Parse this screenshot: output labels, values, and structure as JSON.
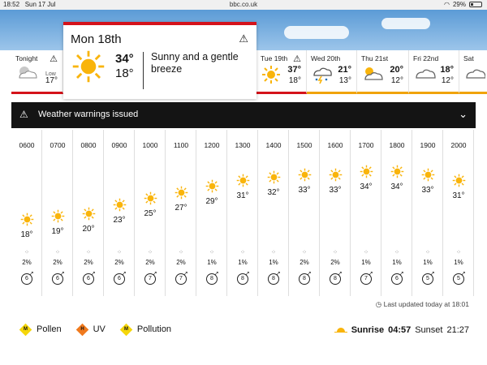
{
  "status": {
    "time": "18:52",
    "date": "Sun 17 Jul",
    "url": "bbc.co.uk",
    "battery": "29%",
    "battery_level": 0.29
  },
  "selected_day": {
    "name": "Mon 18th",
    "high": "34°",
    "low": "18°",
    "description": "Sunny and a gentle breeze",
    "icon": "sunny-icon"
  },
  "days": [
    {
      "name": "Tonight",
      "low_label": "Low",
      "low": "17°",
      "icon": "partly-cloudy-night-icon",
      "warning": true
    },
    {
      "name": "Tue 19th",
      "high": "37°",
      "low": "18°",
      "icon": "sunny-icon",
      "warning": true
    },
    {
      "name": "Wed 20th",
      "high": "21°",
      "low": "13°",
      "icon": "thunder-rain-icon"
    },
    {
      "name": "Thu 21st",
      "high": "20°",
      "low": "12°",
      "icon": "sunny-cloud-icon"
    },
    {
      "name": "Fri 22nd",
      "high": "18°",
      "low": "12°",
      "icon": "cloud-icon"
    },
    {
      "name": "Sat",
      "icon": "cloud-icon"
    }
  ],
  "warnings": {
    "label": "Weather warnings issued"
  },
  "hourly": [
    {
      "time": "0600",
      "temp": "18°",
      "rain": "2%",
      "wind": "6"
    },
    {
      "time": "0700",
      "temp": "19°",
      "rain": "2%",
      "wind": "6"
    },
    {
      "time": "0800",
      "temp": "20°",
      "rain": "2%",
      "wind": "6"
    },
    {
      "time": "0900",
      "temp": "23°",
      "rain": "2%",
      "wind": "6"
    },
    {
      "time": "1000",
      "temp": "25°",
      "rain": "2%",
      "wind": "7"
    },
    {
      "time": "1100",
      "temp": "27°",
      "rain": "2%",
      "wind": "7"
    },
    {
      "time": "1200",
      "temp": "29°",
      "rain": "1%",
      "wind": "8"
    },
    {
      "time": "1300",
      "temp": "31°",
      "rain": "1%",
      "wind": "8"
    },
    {
      "time": "1400",
      "temp": "32°",
      "rain": "1%",
      "wind": "8"
    },
    {
      "time": "1500",
      "temp": "33°",
      "rain": "2%",
      "wind": "8"
    },
    {
      "time": "1600",
      "temp": "33°",
      "rain": "2%",
      "wind": "8"
    },
    {
      "time": "1700",
      "temp": "34°",
      "rain": "1%",
      "wind": "7"
    },
    {
      "time": "1800",
      "temp": "34°",
      "rain": "1%",
      "wind": "6"
    },
    {
      "time": "1900",
      "temp": "33°",
      "rain": "1%",
      "wind": "5"
    },
    {
      "time": "2000",
      "temp": "31°",
      "rain": "1%",
      "wind": "5"
    }
  ],
  "footer": {
    "updated": "Last updated today at 18:01",
    "pollen": {
      "letter": "M",
      "label": "Pollen",
      "color": "#f5d60a"
    },
    "uv": {
      "letter": "H",
      "label": "UV",
      "color": "#f07a1e"
    },
    "pollution": {
      "letter": "M",
      "label": "Pollution",
      "color": "#f5d60a"
    },
    "sunrise_label": "Sunrise",
    "sunrise": "04:57",
    "sunset_label": "Sunset",
    "sunset": "21:27"
  },
  "colors": {
    "warning_red": "#d4121a",
    "warning_amber": "#f0a30a",
    "sun": "#f9b40b"
  }
}
